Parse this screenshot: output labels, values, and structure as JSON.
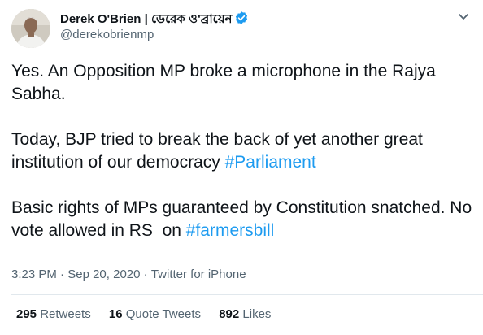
{
  "author": {
    "display_name": "Derek O'Brien | ডেরেক ও'ব্রায়েন",
    "handle": "@derekobrienmp",
    "verified": true
  },
  "icons": {
    "verified": "verified-badge-icon",
    "more": "chevron-down-icon"
  },
  "tweet": {
    "line1": "Yes. An Opposition MP broke a microphone in the Rajya Sabha.",
    "line2_text": "Today, BJP tried to break the back of yet another great institution of our democracy ",
    "line2_hashtag": "#Parliament",
    "line3_text": "Basic rights of MPs guaranteed by Constitution snatched. No vote allowed in RS  on ",
    "line3_hashtag": "#farmersbill"
  },
  "meta": {
    "time": "3:23 PM",
    "separator": " · ",
    "date": "Sep 20, 2020",
    "source": "Twitter for iPhone"
  },
  "stats": {
    "retweets_count": "295",
    "retweets_label": " Retweets",
    "quote_count": "16",
    "quote_label": " Quote Tweets",
    "likes_count": "892",
    "likes_label": " Likes"
  },
  "colors": {
    "link": "#1d9bf0",
    "verified": "#1d9bf0",
    "secondary_text": "#536471",
    "primary_text": "#0f1419"
  }
}
